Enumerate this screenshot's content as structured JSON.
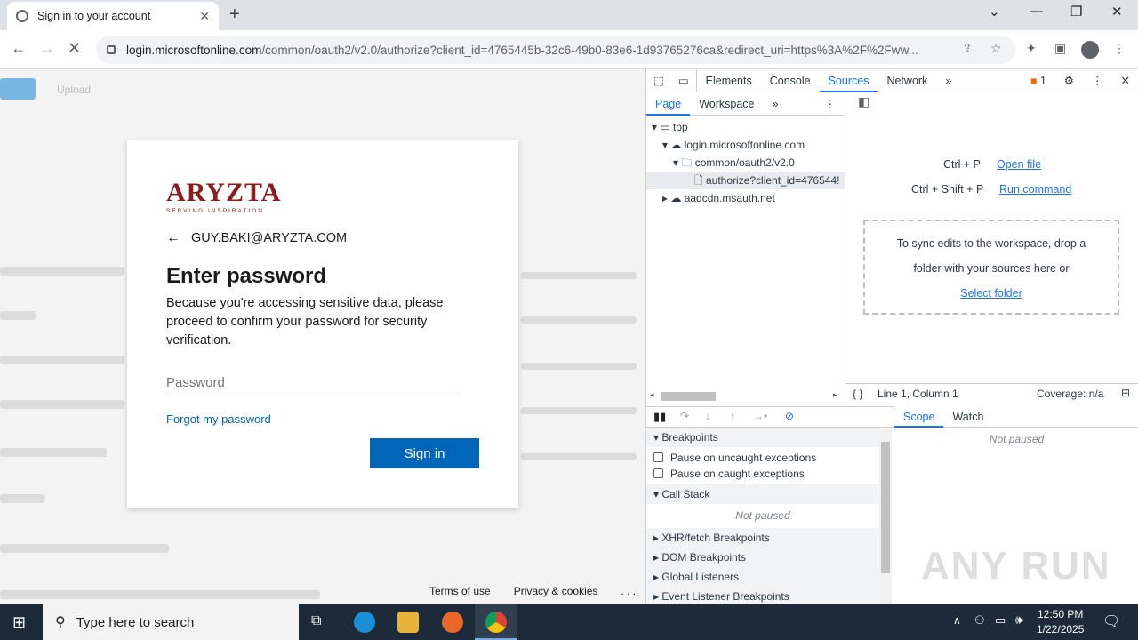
{
  "browser": {
    "tab_title": "Sign in to your account",
    "url_host": "login.microsoftonline.com",
    "url_rest": "/common/oauth2/v2.0/authorize?client_id=4765445b-32c6-49b0-83e6-1d93765276ca&redirect_uri=https%3A%2F%2Fww..."
  },
  "login": {
    "logo_text": "ARYZTA",
    "logo_sub": "SERVING INSPIRATION",
    "email": "GUY.BAKI@ARYZTA.COM",
    "title": "Enter password",
    "description": "Because you're accessing sensitive data, please proceed to confirm your password for security verification.",
    "password_placeholder": "Password",
    "forgot_link": "Forgot my password",
    "signin_label": "Sign in",
    "terms": "Terms of use",
    "privacy": "Privacy & cookies",
    "more": ". . ."
  },
  "background_page": {
    "upload": "Upload"
  },
  "devtools": {
    "tabs": [
      "Elements",
      "Console",
      "Sources",
      "Network"
    ],
    "issues_count": "1",
    "nav_tabs": [
      "Page",
      "Workspace"
    ],
    "tree": {
      "top": "top",
      "host": "login.microsoftonline.com",
      "folder": "common/oauth2/v2.0",
      "file": "authorize?client_id=476544!",
      "cdn": "aadcdn.msauth.net"
    },
    "shortcuts": [
      {
        "keys": "Ctrl + P",
        "action": "Open file"
      },
      {
        "keys": "Ctrl + Shift + P",
        "action": "Run command"
      }
    ],
    "drop_text_1": "To sync edits to the workspace, drop a",
    "drop_text_2": "folder with your sources here or",
    "select_folder": "Select folder",
    "status_position": "Line 1, Column 1",
    "coverage": "Coverage: n/a",
    "sections": {
      "breakpoints": "Breakpoints",
      "pause_uncaught": "Pause on uncaught exceptions",
      "pause_caught": "Pause on caught exceptions",
      "call_stack": "Call Stack",
      "not_paused": "Not paused",
      "xhr": "XHR/fetch Breakpoints",
      "dom": "DOM Breakpoints",
      "global": "Global Listeners",
      "event": "Event Listener Breakpoints"
    },
    "scope_tabs": [
      "Scope",
      "Watch"
    ],
    "scope_not_paused": "Not paused"
  },
  "watermark": "ANY RUN",
  "taskbar": {
    "search_placeholder": "Type here to search",
    "time": "12:50 PM",
    "date": "1/22/2025"
  }
}
